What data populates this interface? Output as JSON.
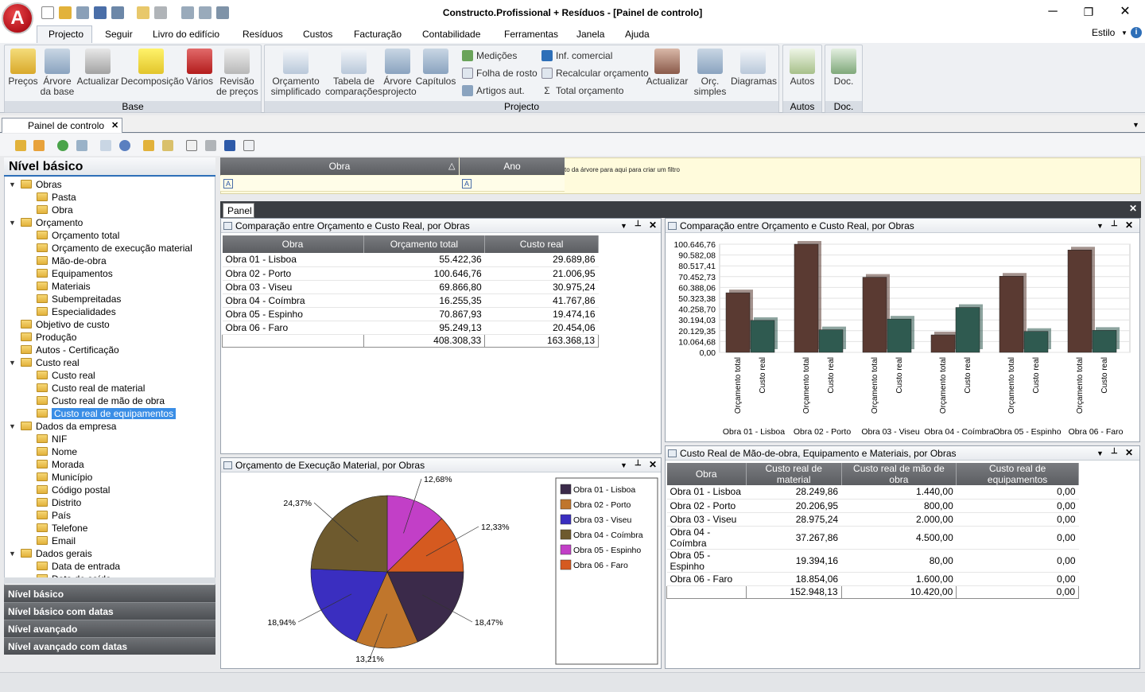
{
  "app": {
    "title": "Constructo.Profissional + Resíduos - [Painel de controlo]",
    "logo_letter": "A"
  },
  "window": {
    "minimize": "─",
    "maximize": "❐",
    "close": "✕"
  },
  "menu": {
    "items": [
      "Projecto",
      "Seguir",
      "Livro do edifício",
      "Resíduos",
      "Custos",
      "Facturação",
      "Contabilidade",
      "Ferramentas",
      "Janela",
      "Ajuda"
    ],
    "style": "Estilo"
  },
  "ribbon": {
    "base": {
      "title": "Base",
      "buttons": [
        "Preços",
        "Árvore\nda base",
        "Actualizar",
        "Decomposição",
        "Vários",
        "Revisão\nde preços"
      ]
    },
    "projecto": {
      "title": "Projecto",
      "buttons": [
        "Orçamento\nsimplificado",
        "Tabela de\ncomparações",
        "Árvore\nprojecto",
        "Capítulos"
      ],
      "small": [
        "Medições",
        "Folha de rosto",
        "Artigos aut.",
        "Inf. comercial",
        "Recalcular orçamento",
        "Total orçamento"
      ],
      "buttons2": [
        "Actualizar",
        "Orç.\nsimples",
        "Diagramas"
      ]
    },
    "autos": {
      "title": "Autos",
      "button": "Autos"
    },
    "doc": {
      "title": "Doc.",
      "button": "Doc."
    }
  },
  "doc_tab": {
    "label": "Painel de controlo",
    "close": "✕"
  },
  "left": {
    "title": "Nível básico",
    "tree": [
      {
        "label": "Obras",
        "level": 0,
        "exp": true
      },
      {
        "label": "Pasta",
        "level": 1
      },
      {
        "label": "Obra",
        "level": 1
      },
      {
        "label": "Orçamento",
        "level": 0,
        "exp": true
      },
      {
        "label": "Orçamento total",
        "level": 1
      },
      {
        "label": "Orçamento de execução material",
        "level": 1
      },
      {
        "label": "Mão-de-obra",
        "level": 1
      },
      {
        "label": "Equipamentos",
        "level": 1
      },
      {
        "label": "Materiais",
        "level": 1
      },
      {
        "label": "Subempreitadas",
        "level": 1
      },
      {
        "label": "Especialidades",
        "level": 1
      },
      {
        "label": "Objetivo de custo",
        "level": 0
      },
      {
        "label": "Produção",
        "level": 0
      },
      {
        "label": "Autos - Certificação",
        "level": 0
      },
      {
        "label": "Custo real",
        "level": 0,
        "exp": true
      },
      {
        "label": "Custo real",
        "level": 1
      },
      {
        "label": "Custo real de material",
        "level": 1
      },
      {
        "label": "Custo real de mão de obra",
        "level": 1
      },
      {
        "label": "Custo real de equipamentos",
        "level": 1,
        "selected": true
      },
      {
        "label": "Dados da empresa",
        "level": 0,
        "exp": true
      },
      {
        "label": "NIF",
        "level": 1
      },
      {
        "label": "Nome",
        "level": 1
      },
      {
        "label": "Morada",
        "level": 1
      },
      {
        "label": "Município",
        "level": 1
      },
      {
        "label": "Código postal",
        "level": 1
      },
      {
        "label": "Distrito",
        "level": 1
      },
      {
        "label": "País",
        "level": 1
      },
      {
        "label": "Telefone",
        "level": 1
      },
      {
        "label": "Email",
        "level": 1
      },
      {
        "label": "Dados gerais",
        "level": 0,
        "exp": true
      },
      {
        "label": "Data de entrada",
        "level": 1
      },
      {
        "label": "Data de saída",
        "level": 1
      }
    ],
    "levels": [
      "Nível básico",
      "Nível básico com datas",
      "Nível avançado",
      "Nível avançado com datas"
    ]
  },
  "filter": {
    "col_obra": "Obra",
    "col_ano": "Ano",
    "hint": "to da árvore para aqui para criar um filtro",
    "sort_glyph": "△",
    "filter_glyph": "A"
  },
  "panel_tab": "Panel",
  "pane_controls": {
    "dropdown": "▼",
    "pin": "📌",
    "close": "✕"
  },
  "pane1": {
    "title": "Comparação entre Orçamento e Custo Real, por Obras",
    "headers": [
      "Obra",
      "Orçamento total",
      "Custo real"
    ],
    "rows": [
      [
        "Obra 01 - Lisboa",
        "55.422,36",
        "29.689,86"
      ],
      [
        "Obra 02 - Porto",
        "100.646,76",
        "21.006,95"
      ],
      [
        "Obra 03 - Viseu",
        "69.866,80",
        "30.975,24"
      ],
      [
        "Obra 04 - Coímbra",
        "16.255,35",
        "41.767,86"
      ],
      [
        "Obra 05 - Espinho",
        "70.867,93",
        "19.474,16"
      ],
      [
        "Obra 06 - Faro",
        "95.249,13",
        "20.454,06"
      ]
    ],
    "totals": [
      "",
      "408.308,33",
      "163.368,13"
    ]
  },
  "pane2": {
    "title": "Comparação entre Orçamento e Custo Real, por Obras"
  },
  "pane3": {
    "title": "Orçamento de Execução Material, por Obras"
  },
  "pane4": {
    "title": "Custo Real de Mão-de-obra, Equipamento e Materiais, por Obras",
    "headers": [
      "Obra",
      "Custo real de material",
      "Custo real de mão de obra",
      "Custo real de equipamentos"
    ],
    "rows": [
      [
        "Obra 01 - Lisboa",
        "28.249,86",
        "1.440,00",
        "0,00"
      ],
      [
        "Obra 02 - Porto",
        "20.206,95",
        "800,00",
        "0,00"
      ],
      [
        "Obra 03 - Viseu",
        "28.975,24",
        "2.000,00",
        "0,00"
      ],
      [
        "Obra 04 - Coímbra",
        "37.267,86",
        "4.500,00",
        "0,00"
      ],
      [
        "Obra 05 - Espinho",
        "19.394,16",
        "80,00",
        "0,00"
      ],
      [
        "Obra 06 - Faro",
        "18.854,06",
        "1.600,00",
        "0,00"
      ]
    ],
    "totals": [
      "",
      "152.948,13",
      "10.420,00",
      "0,00"
    ]
  },
  "chart_data": [
    {
      "type": "bar",
      "categories": [
        "Obra 01 - Lisboa",
        "Obra 02 - Porto",
        "Obra 03 - Viseu",
        "Obra 04 - Coímbra",
        "Obra 05 - Espinho",
        "Obra 06 - Faro"
      ],
      "series": [
        {
          "name": "Orçamento total",
          "values": [
            55422.36,
            100646.76,
            69866.8,
            16255.35,
            70867.93,
            95249.13
          ],
          "color": "#5a3a32"
        },
        {
          "name": "Custo real",
          "values": [
            29689.86,
            21006.95,
            30975.24,
            41767.86,
            19474.16,
            20454.06
          ],
          "color": "#2f5a50"
        }
      ],
      "yticks": [
        "100.646,76",
        "90.582,08",
        "80.517,41",
        "70.452,73",
        "60.388,06",
        "50.323,38",
        "40.258,70",
        "30.194,03",
        "20.129,35",
        "10.064,68",
        "0,00"
      ],
      "ylim": [
        0,
        100646.76
      ],
      "grid": true
    },
    {
      "type": "pie",
      "labels": [
        "Obra 01 - Lisboa",
        "Obra 02 - Porto",
        "Obra 03 - Viseu",
        "Obra 04 - Coímbra",
        "Obra 05 - Espinho",
        "Obra 06 - Faro"
      ],
      "values": [
        18.47,
        13.21,
        18.94,
        24.37,
        12.68,
        12.33
      ],
      "value_labels": [
        "18,47%",
        "13,21%",
        "18,94%",
        "24,37%",
        "12,68%",
        "12,33%"
      ],
      "colors": [
        "#3b2a4a",
        "#c0762c",
        "#3a2ec0",
        "#6e5a2e",
        "#c23fc7",
        "#d55a20"
      ],
      "legend": "right"
    }
  ]
}
